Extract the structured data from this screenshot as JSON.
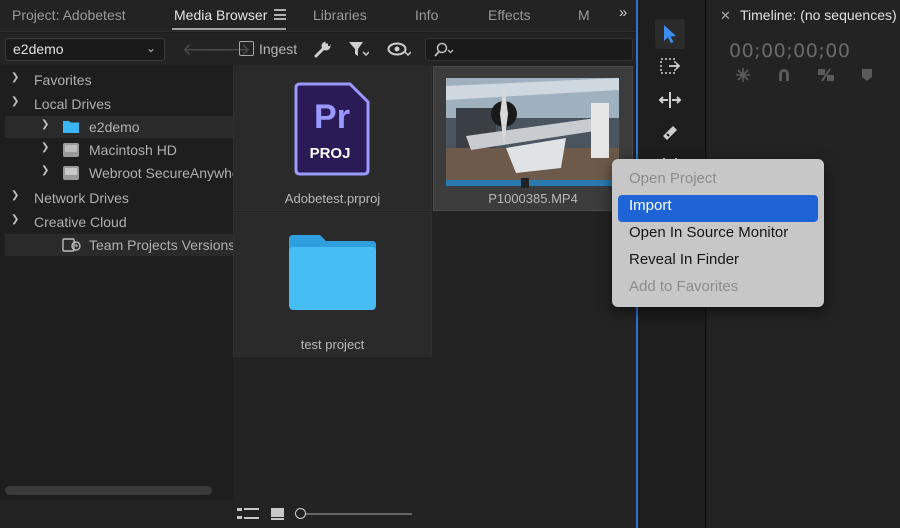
{
  "tabs": [
    {
      "label": "Project: Adobetest",
      "active": false
    },
    {
      "label": "Media Browser",
      "active": true
    },
    {
      "label": "Libraries",
      "active": false
    },
    {
      "label": "Info",
      "active": false
    },
    {
      "label": "Effects",
      "active": false
    },
    {
      "label": "M",
      "active": false
    }
  ],
  "toolbar": {
    "location_value": "e2demo",
    "ingest_label": "Ingest"
  },
  "sidebar": {
    "items": [
      {
        "label": "Favorites",
        "expanded": true,
        "icon": "none"
      },
      {
        "label": "Local Drives",
        "expanded": true,
        "icon": "none"
      },
      {
        "label": "e2demo",
        "expanded": false,
        "icon": "folder-icon"
      },
      {
        "label": "Macintosh HD",
        "expanded": false,
        "icon": "drive-icon"
      },
      {
        "label": "Webroot SecureAnywhe",
        "expanded": false,
        "icon": "drive-icon"
      },
      {
        "label": "Network Drives",
        "expanded": true,
        "icon": "none"
      },
      {
        "label": "Creative Cloud",
        "expanded": true,
        "icon": "none"
      },
      {
        "label": "Team Projects Versions",
        "expanded": false,
        "icon": "team-projects-icon"
      }
    ]
  },
  "files": [
    {
      "name": "Adobetest.prproj",
      "type": "premiere-project",
      "badge_top": "Pr",
      "badge_bottom": "PROJ"
    },
    {
      "name": "P1000385.MP4",
      "type": "video",
      "selected": true
    },
    {
      "name": "test project",
      "type": "folder"
    }
  ],
  "timeline": {
    "title": "Timeline: (no sequences)",
    "timecode": "00;00;00;00"
  },
  "context_menu": {
    "items": [
      {
        "label": "Open Project",
        "state": "disabled"
      },
      {
        "label": "Import",
        "state": "highlighted"
      },
      {
        "label": "Open In Source Monitor",
        "state": "enabled"
      },
      {
        "label": "Reveal In Finder",
        "state": "enabled"
      },
      {
        "label": "Add to Favorites",
        "state": "disabled"
      }
    ]
  },
  "colors": {
    "accent_blue": "#1f64d6",
    "panel_divider": "#2e74d6",
    "premiere_purple": "#9999ff",
    "premiere_bg": "#2a1a55",
    "folder_blue": "#3ab4f2"
  }
}
